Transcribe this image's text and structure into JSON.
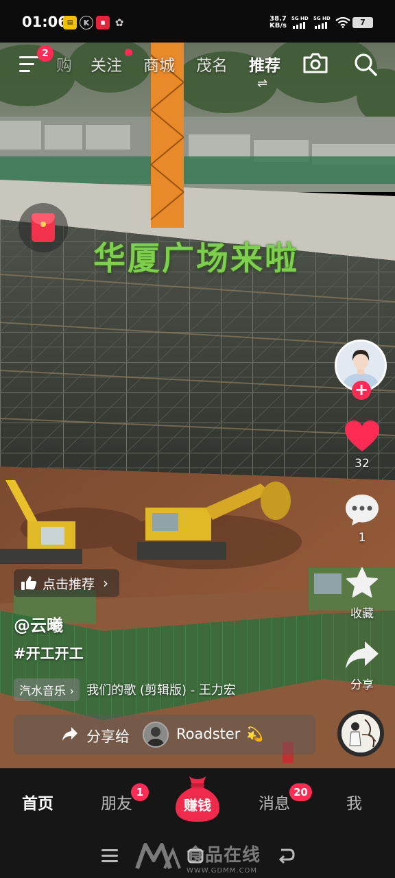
{
  "status_bar": {
    "time": "01:06",
    "net_speed_value": "38.7",
    "net_speed_unit": "KB/s",
    "sim1_label": "5G HD",
    "sim2_label": "5G HD",
    "battery": "7",
    "app_icons": [
      "notes-app-icon",
      "k-app-icon",
      "news-app-icon",
      "pinwheel-app-icon"
    ]
  },
  "top_nav": {
    "menu_badge": "2",
    "tabs": [
      {
        "label": "购",
        "name": "tab-shopping"
      },
      {
        "label": "关注",
        "name": "tab-following"
      },
      {
        "label": "商城",
        "name": "tab-mall"
      },
      {
        "label": "茂名",
        "name": "tab-local"
      },
      {
        "label": "推荐",
        "name": "tab-recommend",
        "active": true
      }
    ],
    "active_indicator": "⇌"
  },
  "video": {
    "caption": "华厦广场来啦"
  },
  "actions": {
    "like_count": "32",
    "comment_count": "1",
    "favorite_label": "收藏",
    "share_label": "分享"
  },
  "post": {
    "recommend_chip": "点击推荐",
    "author": "@云曦",
    "hashtag": "#开工开工",
    "music_source": "汽水音乐 ›",
    "music_title": "我们的歌 (剪辑版) - 王力宏"
  },
  "share_to": {
    "label": "分享给",
    "name": "Roadster",
    "emoji": "💫"
  },
  "bottom_tabs": {
    "home": "首页",
    "friends": "朋友",
    "friends_badge": "1",
    "earn": "赚钱",
    "messages": "消息",
    "messages_badge": "20",
    "me": "我"
  },
  "watermark": {
    "main": "食品在线",
    "url": "WWW.GDMM.COM"
  },
  "colors": {
    "accent": "#fe2c55",
    "caption_green": "#7fcf4e",
    "crane_orange": "#e8892a",
    "earth": "#8a4a2a"
  }
}
